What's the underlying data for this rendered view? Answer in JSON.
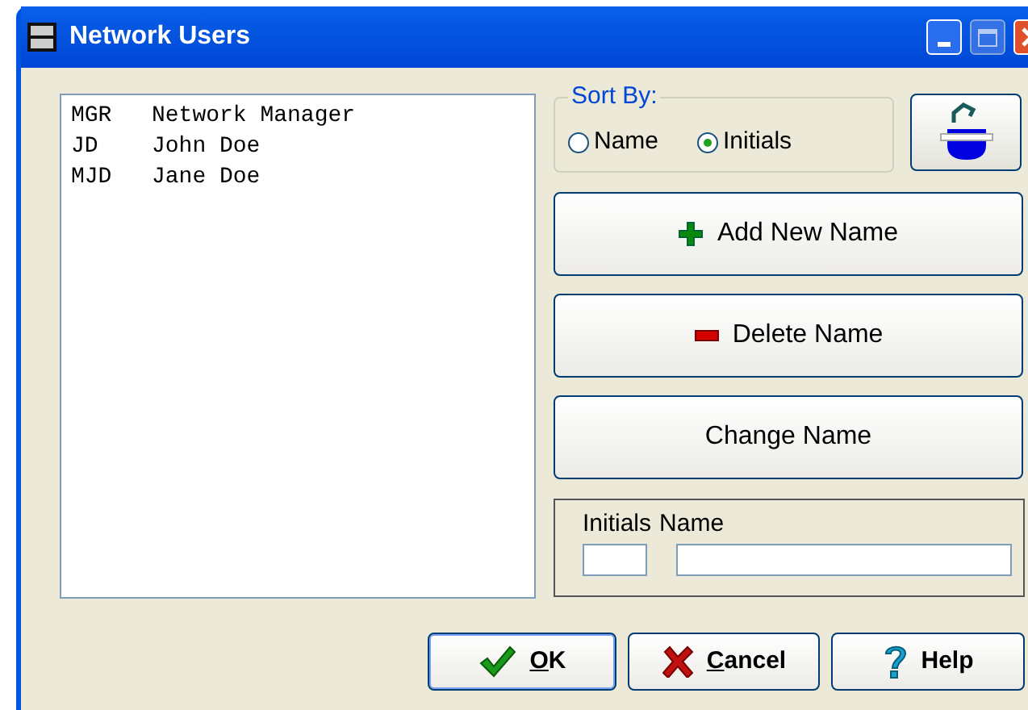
{
  "window": {
    "title": "Network Users"
  },
  "users": [
    {
      "initials": "MGR",
      "name": "Network Manager"
    },
    {
      "initials": "JD",
      "name": "John Doe"
    },
    {
      "initials": "MJD",
      "name": "Jane Doe"
    }
  ],
  "sort_by": {
    "label": "Sort By:",
    "options": [
      {
        "label": "Name",
        "selected": false
      },
      {
        "label": "Initials",
        "selected": true
      }
    ]
  },
  "actions": [
    {
      "kind": "add",
      "label": "Add New Name"
    },
    {
      "kind": "delete",
      "label": "Delete Name"
    },
    {
      "kind": "change",
      "label": "Change Name"
    }
  ],
  "fields": [
    {
      "label": "Initials"
    },
    {
      "label": "Name"
    }
  ],
  "buttons": [
    {
      "kind": "ok",
      "label": "OK",
      "mnemonic_underlined": true
    },
    {
      "kind": "cancel",
      "label": "Cancel",
      "mnemonic_underlined": true
    },
    {
      "kind": "help",
      "label": "Help",
      "mnemonic_underlined": false
    }
  ]
}
